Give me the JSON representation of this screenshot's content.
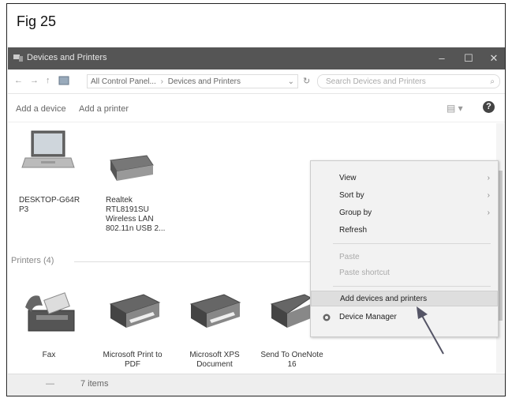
{
  "figure_label": "Fig 25",
  "window": {
    "title": "Devices and Printers",
    "min": "–",
    "max": "☐",
    "close": "✕"
  },
  "address": {
    "back": "←",
    "forward": "→",
    "up": "↑",
    "crumb1": "All Control Panel...",
    "crumb2": "Devices and Printers",
    "chevron": "›",
    "dropdown": "⌄",
    "refresh": "↻",
    "search_placeholder": "Search Devices and Printers",
    "search_icon": "⌕"
  },
  "toolbar": {
    "add_device": "Add a device",
    "add_printer": "Add a printer",
    "view": "▤ ▾",
    "help": "?"
  },
  "devices": [
    {
      "line1": "DESKTOP-G64R",
      "line2": "P3",
      "line3": "",
      "line4": ""
    },
    {
      "line1": "Realtek",
      "line2": "RTL8191SU",
      "line3": "Wireless LAN",
      "line4": "802.11n USB 2..."
    }
  ],
  "printers_section": "Printers (4)",
  "printers": [
    {
      "line1": "Fax",
      "line2": ""
    },
    {
      "line1": "Microsoft Print",
      "line2": "to PDF"
    },
    {
      "line1": "Microsoft XPS",
      "line2": "Document"
    },
    {
      "line1": "Send To",
      "line2": "OneNote 16"
    }
  ],
  "status": {
    "items": "7 items",
    "dash": "—"
  },
  "context_menu": {
    "view": "View",
    "sort_by": "Sort by",
    "group_by": "Group by",
    "refresh": "Refresh",
    "paste": "Paste",
    "paste_shortcut": "Paste shortcut",
    "add_devices": "Add devices and printers",
    "device_manager": "Device Manager",
    "arrow": "›"
  },
  "icons": {
    "window": "devices-icon",
    "laptop": "laptop-icon",
    "usb": "usb-adapter-icon",
    "fax": "fax-icon",
    "printer": "printer-icon",
    "gear": "device-manager-icon"
  },
  "colors": {
    "titlebar": "#555555",
    "menu_bg": "#f2f2f2",
    "highlight": "#dedede"
  }
}
